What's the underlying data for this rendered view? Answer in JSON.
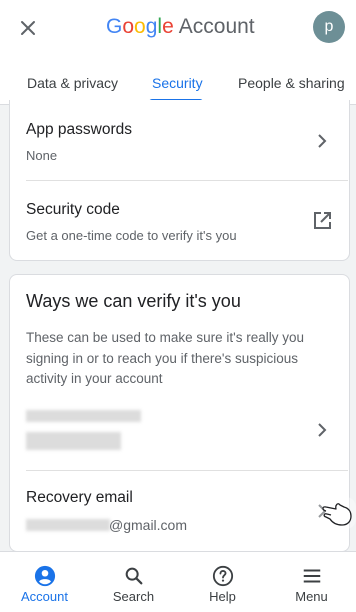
{
  "header": {
    "close_icon": "close-icon",
    "brand_word": "Google",
    "title": "Account",
    "avatar_letter": "p",
    "colors": {
      "blue": "#4285f4",
      "red": "#ea4335",
      "yellow": "#fbbc05",
      "green": "#34a853",
      "avatar": "#6d8f96"
    }
  },
  "tabs": [
    {
      "label": "Data & privacy"
    },
    {
      "label": "Security",
      "active": true
    },
    {
      "label": "People & sharing"
    }
  ],
  "security_card": {
    "items": [
      {
        "title": "App passwords",
        "subtitle": "None",
        "icon": "chevron-right-icon"
      },
      {
        "title": "Security code",
        "subtitle": "Get a one-time code to verify it's you",
        "icon": "open-in-new-icon"
      }
    ]
  },
  "verify_card": {
    "title": "Ways we can verify it's you",
    "description": "These can be used to make sure it's really you signing in or to reach you if there's suspicious activity in your account",
    "recovery_email": {
      "title": "Recovery email",
      "value": "@gmail.com",
      "icon": "chevron-right-icon"
    }
  },
  "bottom_nav": [
    {
      "label": "Account",
      "icon": "account-circle-icon",
      "active": true
    },
    {
      "label": "Search",
      "icon": "search-icon"
    },
    {
      "label": "Help",
      "icon": "help-icon"
    },
    {
      "label": "Menu",
      "icon": "menu-icon"
    }
  ],
  "accent_color": "#1a73e8"
}
